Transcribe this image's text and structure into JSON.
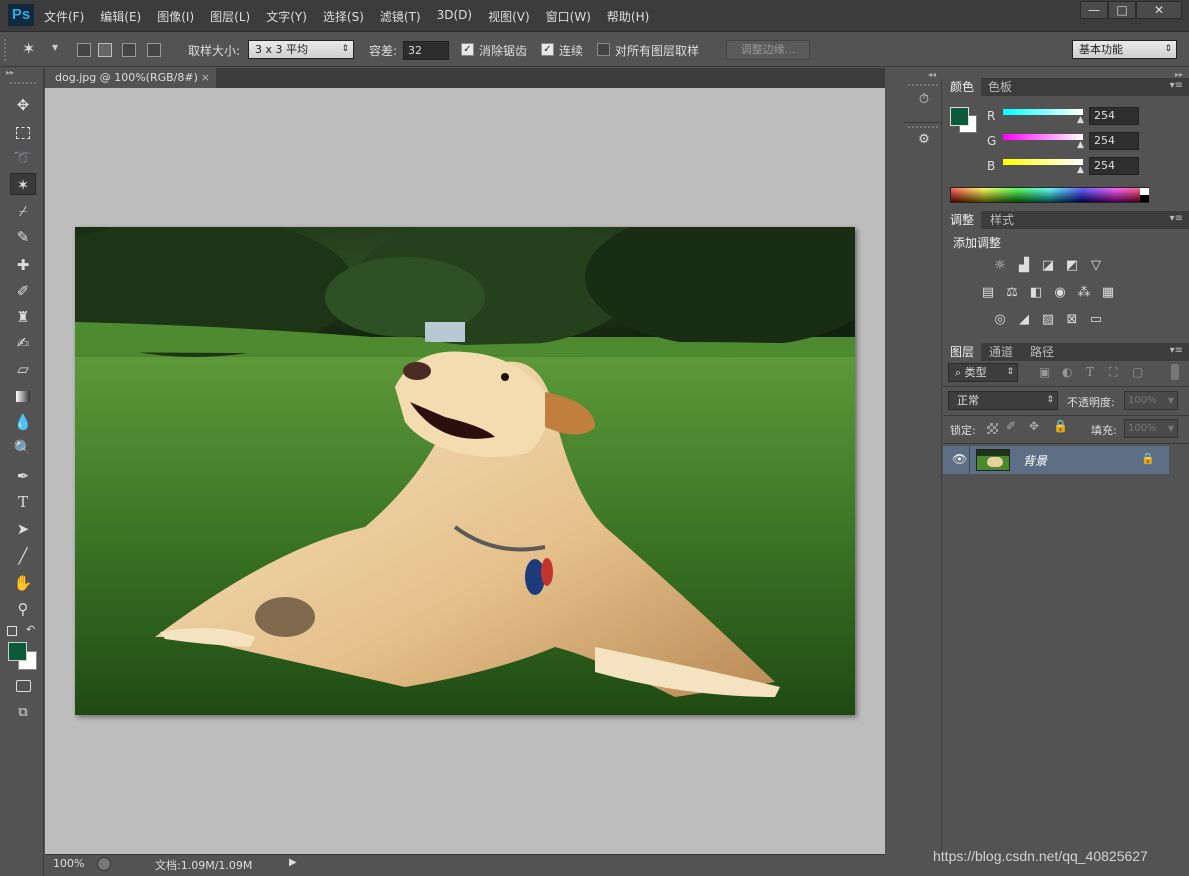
{
  "app": {
    "logo": "Ps",
    "menus": [
      "文件(F)",
      "编辑(E)",
      "图像(I)",
      "图层(L)",
      "文字(Y)",
      "选择(S)",
      "滤镜(T)",
      "3D(D)",
      "视图(V)",
      "窗口(W)",
      "帮助(H)"
    ],
    "window_controls": {
      "minimize": "—",
      "maximize": "□",
      "close": "✕"
    }
  },
  "options": {
    "sample_size_label": "取样大小:",
    "sample_size_value": "3 x 3 平均",
    "tolerance_label": "容差:",
    "tolerance_value": "32",
    "antialias_label": "消除锯齿",
    "contiguous_label": "连续",
    "sample_all_layers_label": "对所有图层取样",
    "refine_edge_label": "调整边缘...",
    "workspace_value": "基本功能"
  },
  "document": {
    "tab_title": "dog.jpg @ 100%(RGB/8#)",
    "tab_close": "×",
    "zoom": "100%",
    "doc_size": "文档:1.09M/1.09M"
  },
  "color_panel": {
    "tabs": [
      "颜色",
      "色板"
    ],
    "r_label": "R",
    "g_label": "G",
    "b_label": "B",
    "r_value": "254",
    "g_value": "254",
    "b_value": "254",
    "foreground": "#0d5a3a",
    "background": "#ffffff"
  },
  "adjust_panel": {
    "tabs": [
      "调整",
      "样式"
    ],
    "heading": "添加调整"
  },
  "layers_panel": {
    "tabs": [
      "图层",
      "通道",
      "路径"
    ],
    "filter_label": "类型",
    "blend_mode": "正常",
    "opacity_label": "不透明度:",
    "opacity_value": "100%",
    "lock_label": "锁定:",
    "fill_label": "填充:",
    "fill_value": "100%",
    "layer_name": "背景"
  },
  "watermark": "https://blog.csdn.net/qq_40825627"
}
